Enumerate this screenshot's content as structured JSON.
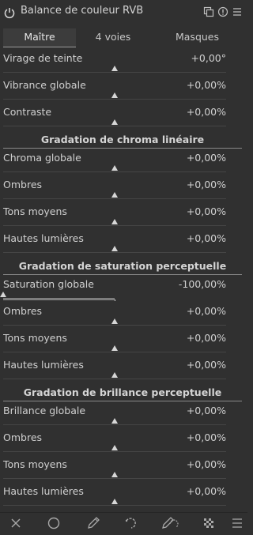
{
  "header": {
    "title": "Balance de couleur RVB"
  },
  "tabs": [
    {
      "label": "Maître"
    },
    {
      "label": "4 voies"
    },
    {
      "label": "Masques"
    }
  ],
  "rows": [
    {
      "label": "Virage de teinte",
      "value": "+0,00°",
      "level": 0.5
    },
    {
      "label": "Vibrance globale",
      "value": "+0,00%",
      "level": 0.5
    },
    {
      "label": "Contraste",
      "value": "+0,00%",
      "level": 0.5
    },
    {
      "label": "Chroma globale",
      "value": "+0,00%",
      "level": 0.5
    },
    {
      "label": "Ombres",
      "value": "+0,00%",
      "level": 0.5
    },
    {
      "label": "Tons moyens",
      "value": "+0,00%",
      "level": 0.5
    },
    {
      "label": "Hautes lumières",
      "value": "+0,00%",
      "level": 0.5
    },
    {
      "label": "Saturation globale",
      "value": "-100,00%",
      "level": 0.0
    },
    {
      "label": "Ombres",
      "value": "+0,00%",
      "level": 0.5
    },
    {
      "label": "Tons moyens",
      "value": "+0,00%",
      "level": 0.5
    },
    {
      "label": "Hautes lumières",
      "value": "+0,00%",
      "level": 0.5
    },
    {
      "label": "Brillance globale",
      "value": "+0,00%",
      "level": 0.5
    },
    {
      "label": "Ombres",
      "value": "+0,00%",
      "level": 0.5
    },
    {
      "label": "Tons moyens",
      "value": "+0,00%",
      "level": 0.5
    },
    {
      "label": "Hautes lumières",
      "value": "+0,00%",
      "level": 0.5
    }
  ],
  "sections": [
    {
      "title": "Gradation de chroma linéaire"
    },
    {
      "title": "Gradation de saturation perceptuelle"
    },
    {
      "title": "Gradation de brillance perceptuelle"
    }
  ],
  "footer_icons": [
    "close-icon",
    "circle-icon",
    "pencil-icon",
    "curve-icon",
    "parametric-icon",
    "checker-icon",
    "menu-icon"
  ],
  "colors": {
    "background": "#303030",
    "text": "#cfcfcf",
    "marker": "#d6d6d6"
  }
}
